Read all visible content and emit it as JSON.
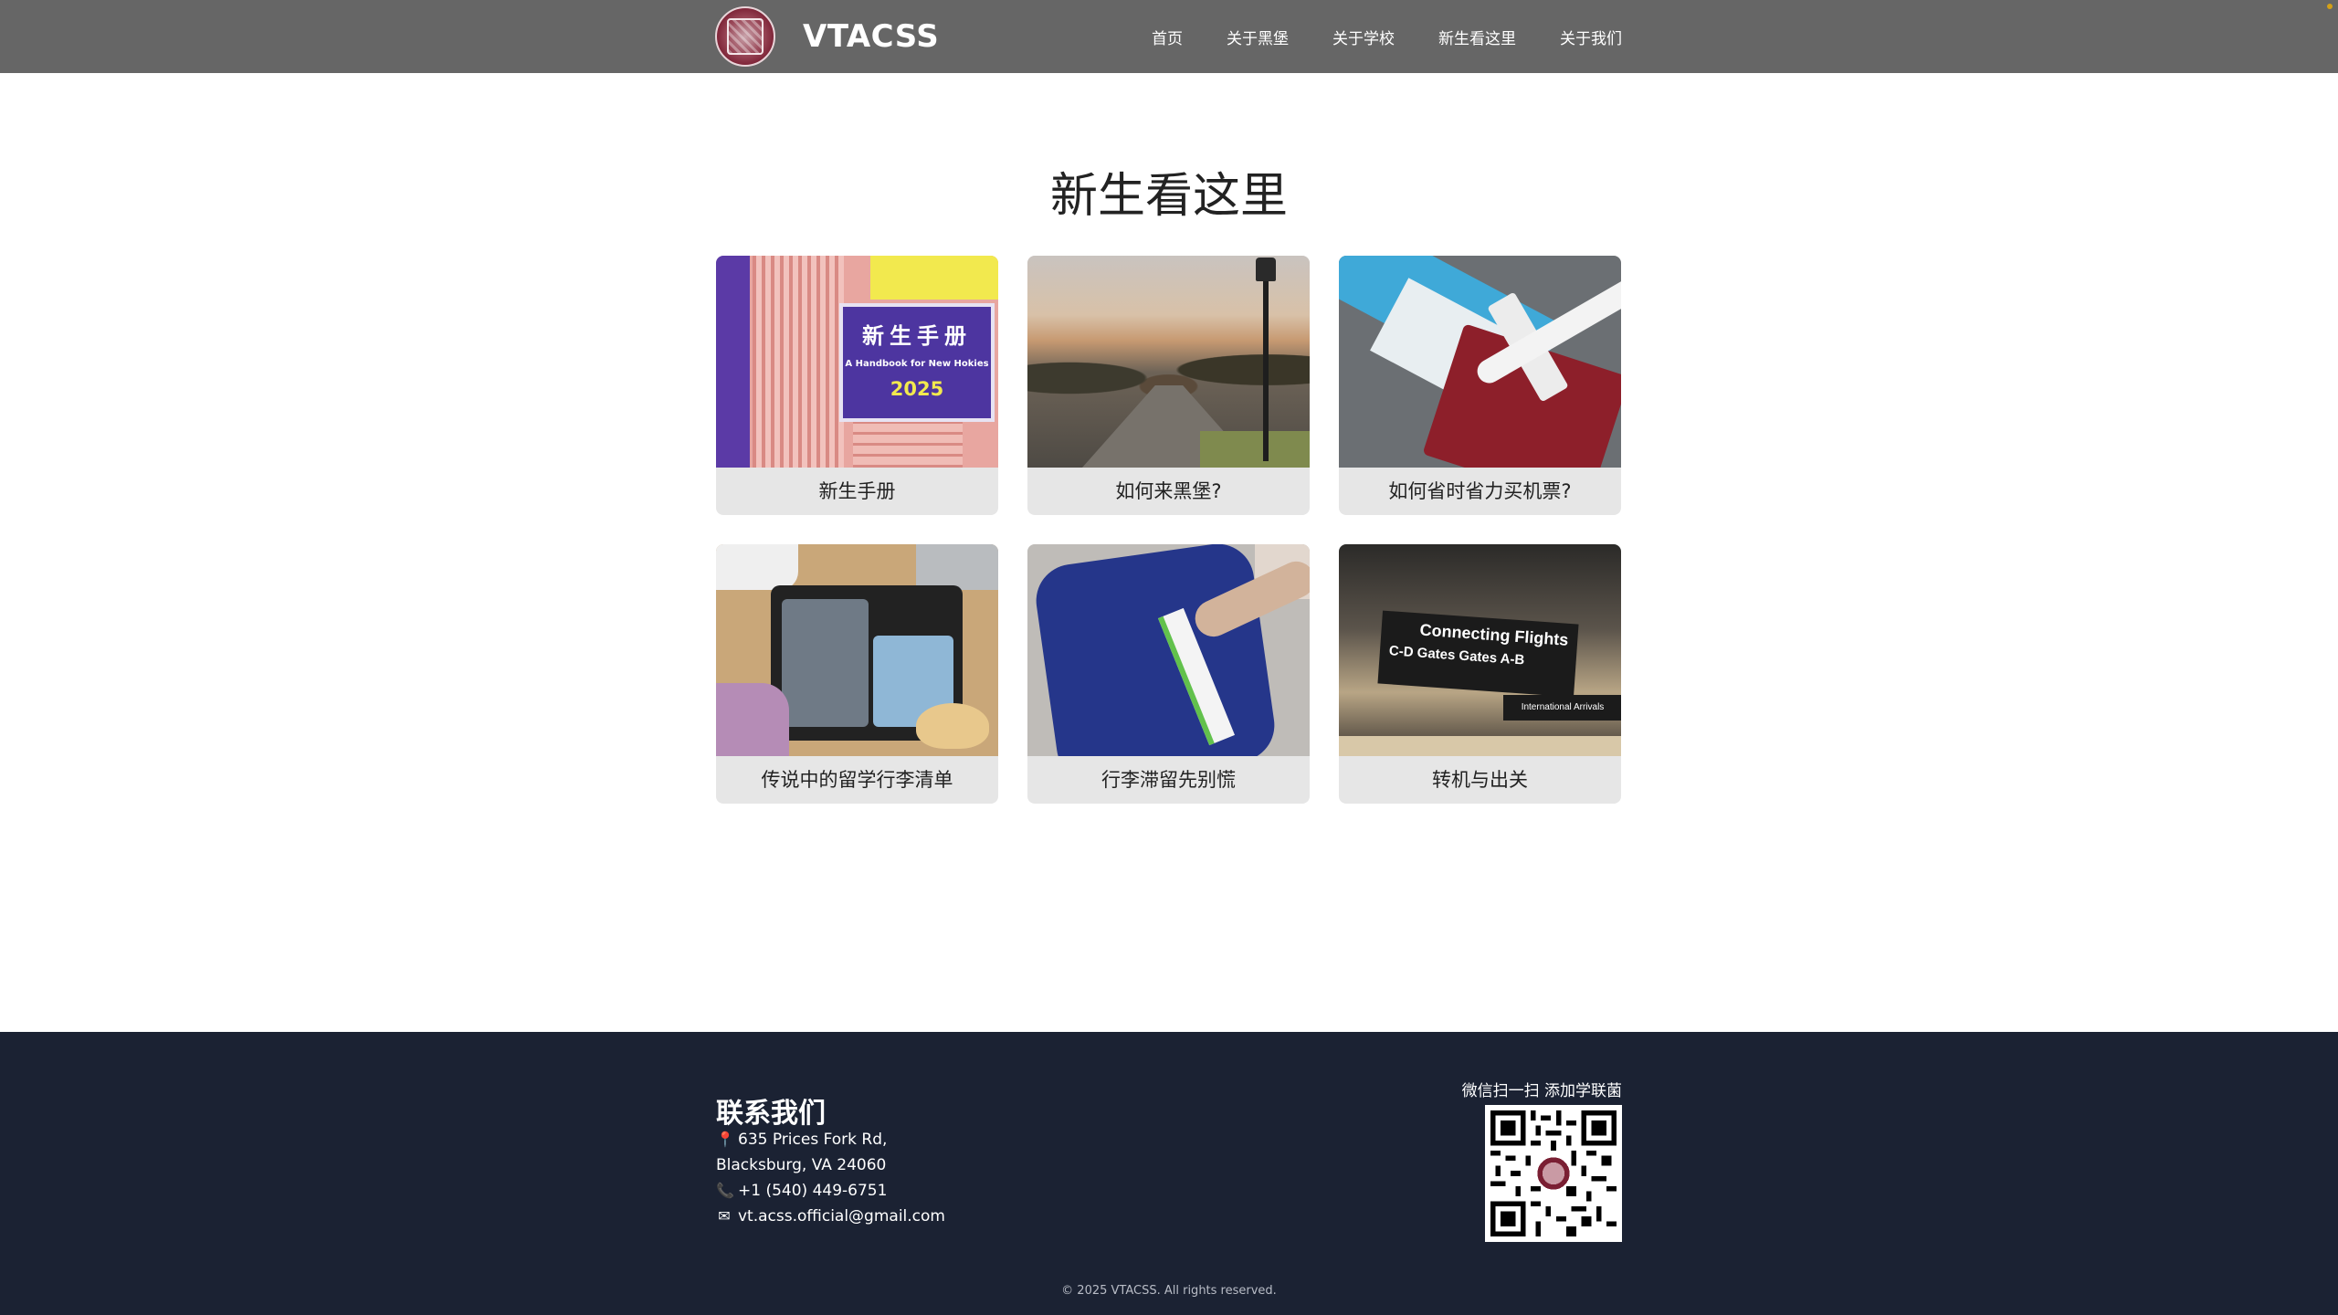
{
  "nav": {
    "brand": "VTACSS",
    "links": [
      "首页",
      "关于黑堡",
      "关于学校",
      "新生看这里",
      "关于我们"
    ]
  },
  "page": {
    "title": "新生看这里"
  },
  "cards": [
    {
      "label": "新生手册",
      "image_text": {
        "title": "新生手册",
        "subtitle": "A Handbook for New Hokies",
        "year": "2025"
      }
    },
    {
      "label": "如何来黑堡?"
    },
    {
      "label": "如何省时省力买机票?"
    },
    {
      "label": "传说中的留学行李清单"
    },
    {
      "label": "行李滞留先别慌"
    },
    {
      "label": "转机与出关",
      "image_text": {
        "sign_title": "Connecting Flights",
        "sign_gates": "C-D Gates   Gates A-B",
        "sign_small": "International Arrivals"
      }
    }
  ],
  "footer": {
    "title": "联系我们",
    "address_line1": "635 Prices Fork Rd,",
    "address_line2": "Blacksburg, VA 24060",
    "phone": "+1 (540) 449-6751",
    "email": "vt.acss.official@gmail.com",
    "qr_caption": "微信扫一扫 添加学联菌",
    "copyright": "© 2025 VTACSS. All rights reserved."
  },
  "icons": {
    "address": "pin-icon",
    "phone": "phone-icon",
    "email": "envelope-icon"
  },
  "colors": {
    "navbar": "#666666",
    "footer": "#1b2233",
    "card_label_bg": "#e6e6e6"
  }
}
